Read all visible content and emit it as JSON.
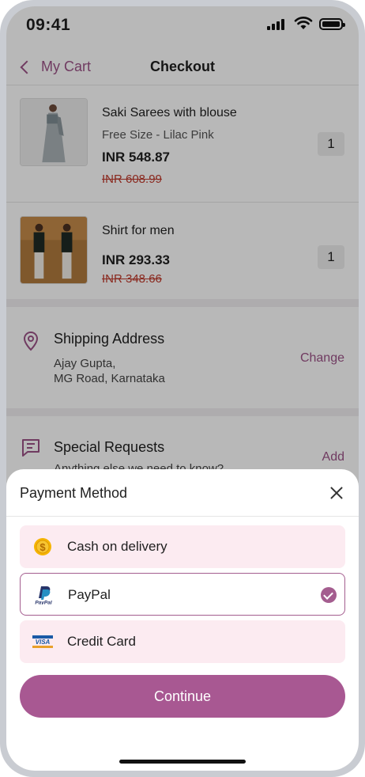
{
  "status_bar": {
    "time": "09:41"
  },
  "nav": {
    "back_label": "My Cart",
    "title": "Checkout"
  },
  "cart": {
    "items": [
      {
        "name": "Saki Sarees with blouse",
        "variant": "Free Size - Lilac Pink",
        "price": "INR 548.87",
        "original_price": "INR 608.99",
        "quantity": "1"
      },
      {
        "name": "Shirt for men",
        "variant": "",
        "price": "INR 293.33",
        "original_price": "INR 348.66",
        "quantity": "1"
      }
    ]
  },
  "shipping": {
    "title": "Shipping Address",
    "line1": "Ajay Gupta,",
    "line2": "MG Road, Karnataka",
    "action": "Change"
  },
  "special_requests": {
    "title": "Special Requests",
    "placeholder": "Anything else we need to know?",
    "action": "Add"
  },
  "payment_sheet": {
    "title": "Payment Method",
    "options": [
      {
        "label": "Cash on delivery",
        "icon": "coin-icon",
        "selected": false
      },
      {
        "label": "PayPal",
        "icon": "paypal-icon",
        "selected": true
      },
      {
        "label": "Credit Card",
        "icon": "visa-card-icon",
        "selected": false
      }
    ],
    "continue_label": "Continue"
  },
  "colors": {
    "accent": "#a85892",
    "option_bg": "#fcebf1"
  }
}
